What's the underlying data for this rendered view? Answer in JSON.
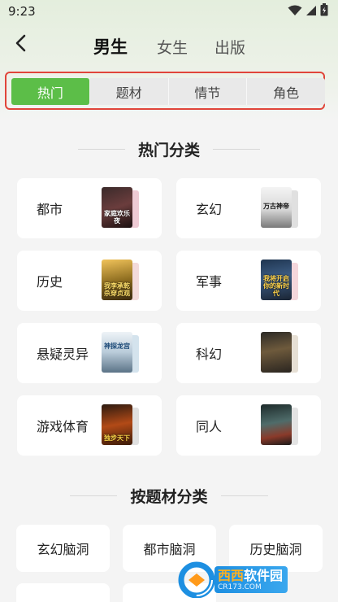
{
  "status_bar": {
    "time": "9:23",
    "icons": [
      "wifi-icon",
      "cellular-icon",
      "battery-icon"
    ]
  },
  "nav": {
    "back_icon": "chevron-left-icon",
    "tabs": [
      {
        "label": "男生",
        "active": true
      },
      {
        "label": "女生",
        "active": false
      },
      {
        "label": "出版",
        "active": false
      }
    ]
  },
  "segments": [
    {
      "label": "热门",
      "active": true
    },
    {
      "label": "题材",
      "active": false
    },
    {
      "label": "情节",
      "active": false
    },
    {
      "label": "角色",
      "active": false
    }
  ],
  "hot_section": {
    "title": "热门分类",
    "categories": [
      {
        "label": "都市",
        "cover_text": "家庭欢乐夜"
      },
      {
        "label": "玄幻",
        "cover_text": "万古神帝"
      },
      {
        "label": "历史",
        "cover_text": "我李承乾杀穿贞观"
      },
      {
        "label": "军事",
        "cover_text": "我将开启你的新时代"
      },
      {
        "label": "悬疑灵异",
        "cover_text": "神探龙宫"
      },
      {
        "label": "科幻",
        "cover_text": ""
      },
      {
        "label": "游戏体育",
        "cover_text": "独步天下"
      },
      {
        "label": "同人",
        "cover_text": ""
      }
    ]
  },
  "theme_section": {
    "title": "按题材分类",
    "items": [
      {
        "label": "玄幻脑洞"
      },
      {
        "label": "都市脑洞"
      },
      {
        "label": "历史脑洞"
      }
    ]
  },
  "watermark": {
    "main_a": "西西",
    "main_b": "软件园",
    "sub": "CR173.COM"
  },
  "colors": {
    "accent_green": "#5cbe48",
    "highlight_red": "#e0453a",
    "watermark_blue": "#1d8fe1"
  }
}
